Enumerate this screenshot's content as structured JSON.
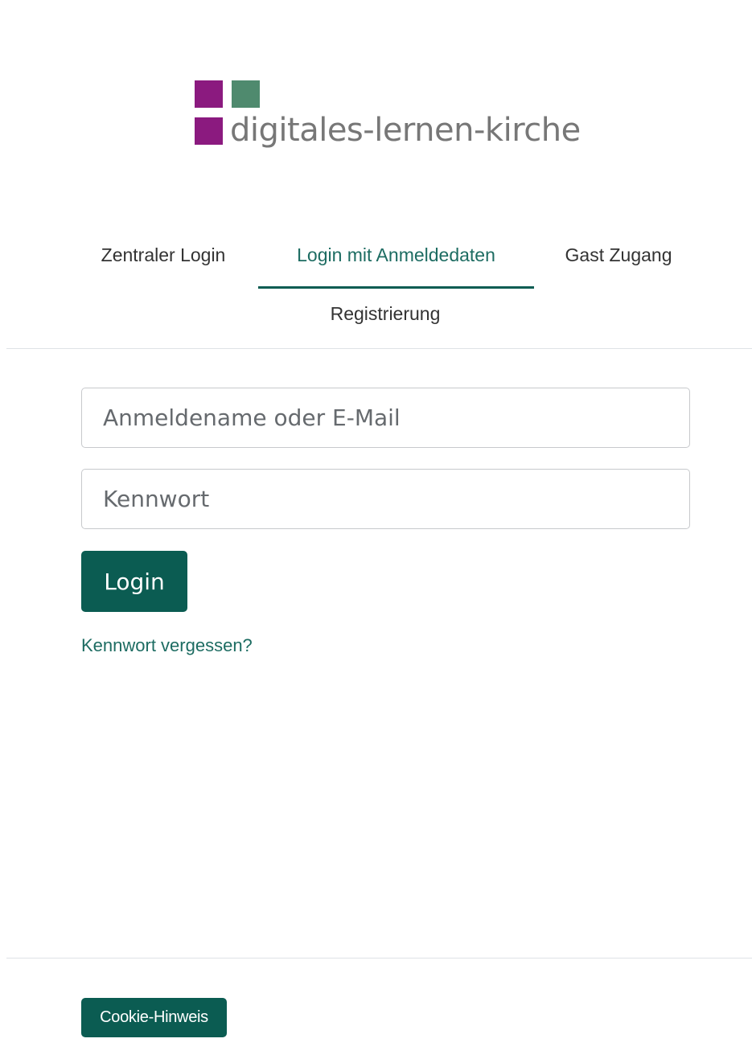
{
  "colors": {
    "brand_purple": "#8b1a7f",
    "brand_green": "#4f8a6e",
    "logo_text": "#777777",
    "primary": "#0b5c52",
    "link": "#1d6c62",
    "tab_active": "#1d6c62",
    "tab_text": "#333333"
  },
  "logo": {
    "text": "digitales-lernen-kirche"
  },
  "tabs": [
    {
      "label": "Zentraler Login",
      "active": false
    },
    {
      "label": "Login mit Anmeldedaten",
      "active": true
    },
    {
      "label": "Gast Zugang",
      "active": false
    },
    {
      "label": "Registrierung",
      "active": false
    }
  ],
  "form": {
    "username_placeholder": "Anmeldename oder E-Mail",
    "username_value": "",
    "password_placeholder": "Kennwort",
    "password_value": "",
    "login_label": "Login",
    "forgot_label": "Kennwort vergessen?"
  },
  "footer": {
    "cookie_label": "Cookie-Hinweis"
  }
}
